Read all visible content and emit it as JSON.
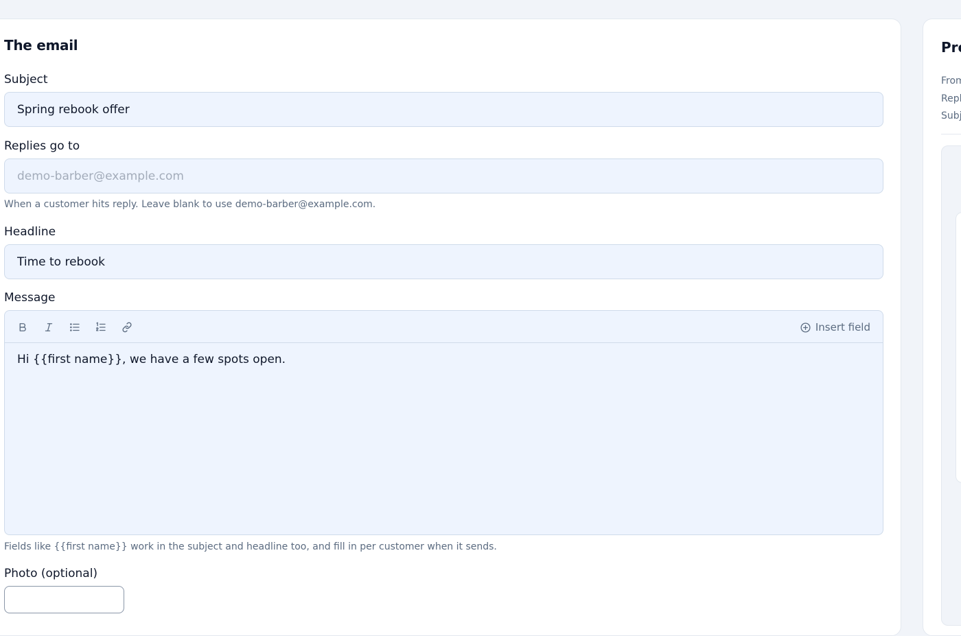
{
  "email_form": {
    "section_title": "The email",
    "subject": {
      "label": "Subject",
      "value": "Spring rebook offer"
    },
    "replies_to": {
      "label": "Replies go to",
      "value": "",
      "placeholder": "demo-barber@example.com",
      "help": "When a customer hits reply. Leave blank to use demo-barber@example.com."
    },
    "headline": {
      "label": "Headline",
      "value": "Time to rebook"
    },
    "message": {
      "label": "Message",
      "toolbar": {
        "icons": [
          "bold-icon",
          "italic-icon",
          "bullet-list-icon",
          "numbered-list-icon",
          "link-icon"
        ],
        "insert_field_label": "Insert field",
        "insert_field_icon": "plus-circle-icon"
      },
      "body": "Hi {{first name}}, we have a few spots open.",
      "help": "Fields like {{first name}} work in the subject and headline too, and fill in per customer when it sends."
    },
    "photo": {
      "label": "Photo (optional)"
    }
  },
  "preview": {
    "title": "Pre",
    "from_label": "From",
    "reply_label": "Repl",
    "subject_label": "Subj"
  },
  "colors": {
    "page_bg": "#f1f4f9",
    "card_bg": "#ffffff",
    "input_bg": "#eef4fe",
    "input_border": "#cfdbea",
    "text": "#0f172a",
    "muted": "#5b6b80",
    "placeholder": "#a3acba"
  }
}
